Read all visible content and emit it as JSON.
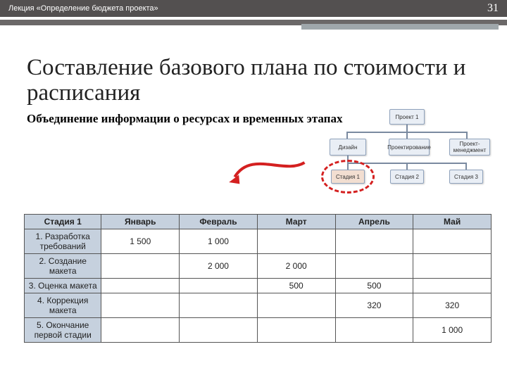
{
  "topbar": {
    "lecture": "Лекция «Определение бюджета проекта»",
    "page": "31"
  },
  "title": "Составление базового плана по стоимости и расписания",
  "subtitle": "Объединение информации о ресурсах и временных этапах",
  "diagram": {
    "root": "Проект 1",
    "mid": [
      "Дизайн",
      "Проектирование",
      "Проект-менеджмент"
    ],
    "leaf": [
      "Стадия 1",
      "Стадия 2",
      "Стадия 3"
    ]
  },
  "table": {
    "col0": "Стадия 1",
    "months": [
      "Январь",
      "Февраль",
      "Март",
      "Апрель",
      "Май"
    ],
    "rows": [
      {
        "label": "1. Разработка требований",
        "cells": [
          "1 500",
          "1 000",
          "",
          "",
          ""
        ]
      },
      {
        "label": "2. Создание макета",
        "cells": [
          "",
          "2 000",
          "2 000",
          "",
          ""
        ]
      },
      {
        "label": "3. Оценка макета",
        "cells": [
          "",
          "",
          "500",
          "500",
          ""
        ]
      },
      {
        "label": "4. Коррекция макета",
        "cells": [
          "",
          "",
          "",
          "320",
          "320"
        ]
      },
      {
        "label": "5. Окончание первой стадии",
        "cells": [
          "",
          "",
          "",
          "",
          "1 000"
        ]
      }
    ]
  },
  "chart_data": {
    "type": "table",
    "title": "Стадия 1 — распределение затрат по месяцам",
    "categories": [
      "Январь",
      "Февраль",
      "Март",
      "Апрель",
      "Май"
    ],
    "series": [
      {
        "name": "1. Разработка требований",
        "values": [
          1500,
          1000,
          null,
          null,
          null
        ]
      },
      {
        "name": "2. Создание макета",
        "values": [
          null,
          2000,
          2000,
          null,
          null
        ]
      },
      {
        "name": "3. Оценка макета",
        "values": [
          null,
          null,
          500,
          500,
          null
        ]
      },
      {
        "name": "4. Коррекция макета",
        "values": [
          null,
          null,
          null,
          320,
          320
        ]
      },
      {
        "name": "5. Окончание первой стадии",
        "values": [
          null,
          null,
          null,
          null,
          1000
        ]
      }
    ]
  }
}
